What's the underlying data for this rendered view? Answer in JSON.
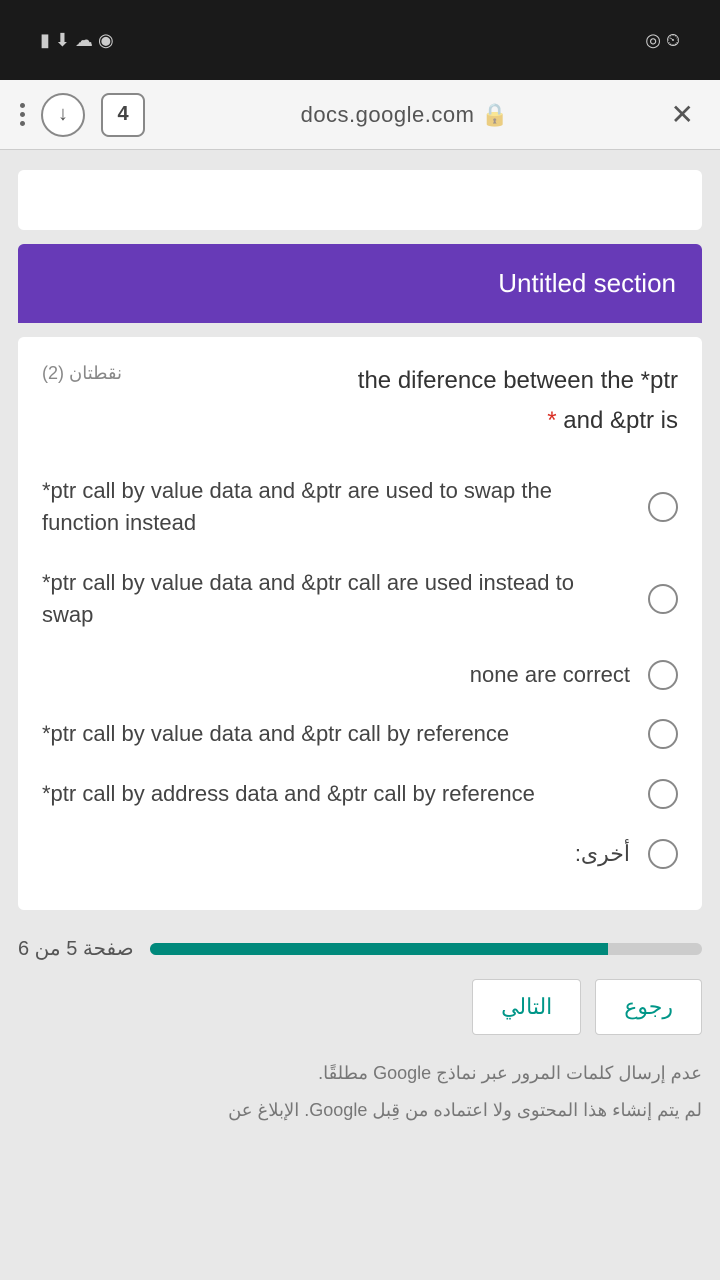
{
  "status": {
    "left_icons": "▮ ⬇ ☁ ◉",
    "right_icons": "◎ ⏲"
  },
  "browser": {
    "tab_count": "4",
    "url": "docs.google.com"
  },
  "section": {
    "title": "Untitled section"
  },
  "question": {
    "points": "نقطتان (2)",
    "title_line1": "the diference between the *ptr",
    "title_line2": "and &ptr is",
    "required": "*"
  },
  "options": [
    "*ptr call by value data and &ptr are used to swap the function instead",
    "*ptr call by value data and &ptr call are used instead to swap",
    "none are correct",
    "*ptr call by value data and &ptr call by reference",
    "*ptr call by address data and &ptr call by reference",
    "أخرى:"
  ],
  "pager": {
    "label": "صفحة 5 من 6"
  },
  "nav": {
    "back": "رجوع",
    "next": "التالي"
  },
  "footer": {
    "line1": "عدم إرسال كلمات المرور عبر نماذج Google مطلقًا.",
    "line2": "لم يتم إنشاء هذا المحتوى ولا اعتماده من قِبل Google. الإبلاغ عن"
  }
}
